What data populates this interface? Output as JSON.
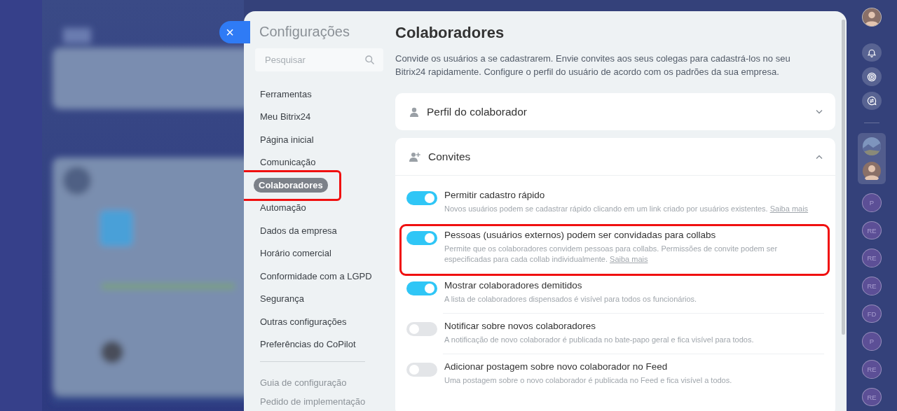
{
  "close_button": {
    "label": "×"
  },
  "settings": {
    "title": "Configurações",
    "search": {
      "placeholder": "Pesquisar"
    },
    "menu": [
      {
        "label": "Ferramentas",
        "selected": false,
        "highlighted": false
      },
      {
        "label": "Meu Bitrix24",
        "selected": false,
        "highlighted": false
      },
      {
        "label": "Página inicial",
        "selected": false,
        "highlighted": false
      },
      {
        "label": "Comunicação",
        "selected": false,
        "highlighted": false
      },
      {
        "label": "Colaboradores",
        "selected": true,
        "highlighted": true
      },
      {
        "label": "Automação",
        "selected": false,
        "highlighted": false
      },
      {
        "label": "Dados da empresa",
        "selected": false,
        "highlighted": false
      },
      {
        "label": "Horário comercial",
        "selected": false,
        "highlighted": false
      },
      {
        "label": "Conformidade com a LGPD",
        "selected": false,
        "highlighted": false
      },
      {
        "label": "Segurança",
        "selected": false,
        "highlighted": false
      },
      {
        "label": "Outras configurações",
        "selected": false,
        "highlighted": false
      },
      {
        "label": "Preferências do CoPilot",
        "selected": false,
        "highlighted": false
      }
    ],
    "footer_links": [
      "Guia de configuração",
      "Pedido de implementação"
    ]
  },
  "page": {
    "title": "Colaboradores",
    "description": "Convide os usuários a se cadastrarem. Envie convites aos seus colegas para cadastrá-los no seu Bitrix24 rapidamente. Configure o perfil do usuário de acordo com os padrões da sua empresa.",
    "sections": [
      {
        "title": "Perfil do colaborador",
        "kind": "profile",
        "expanded": false
      },
      {
        "title": "Convites",
        "kind": "invite",
        "expanded": true,
        "options": [
          {
            "label": "Permitir cadastro rápido",
            "description": "Novos usuários podem se cadastrar rápido clicando em um link criado por usuários existentes.",
            "link": "Saiba mais",
            "on": true,
            "highlighted": false
          },
          {
            "label": "Pessoas (usuários externos) podem ser convidadas para collabs",
            "description": "Permite que os colaboradores convidem pessoas para collabs. Permissões de convite podem ser especificadas para cada collab individualmente.",
            "link": "Saiba mais",
            "on": true,
            "highlighted": true
          },
          {
            "label": "Mostrar colaboradores demitidos",
            "description": "A lista de colaboradores dispensados é visível para todos os funcionários.",
            "on": true,
            "highlighted": false
          },
          {
            "label": "Notificar sobre novos colaboradores",
            "description": "A notificação de novo colaborador é publicada no bate-papo geral e fica visível para todos.",
            "on": false,
            "highlighted": false
          },
          {
            "label": "Adicionar postagem sobre novo colaborador no Feed",
            "description": "Uma postagem sobre o novo colaborador é publicada no Feed e fica visível a todos.",
            "on": false,
            "highlighted": false
          }
        ]
      }
    ]
  },
  "rail": {
    "top": [
      {
        "kind": "avatar"
      },
      {
        "kind": "bell"
      },
      {
        "kind": "copilot"
      },
      {
        "kind": "chat"
      }
    ],
    "pinned": [
      {
        "kind": "picture"
      },
      {
        "kind": "avatar"
      }
    ],
    "chats": [
      {
        "initials": "P"
      },
      {
        "initials": "RE"
      },
      {
        "initials": "RE"
      },
      {
        "initials": "RE"
      },
      {
        "initials": "FD"
      },
      {
        "initials": "P"
      },
      {
        "initials": "RE"
      },
      {
        "initials": "RE"
      }
    ]
  }
}
